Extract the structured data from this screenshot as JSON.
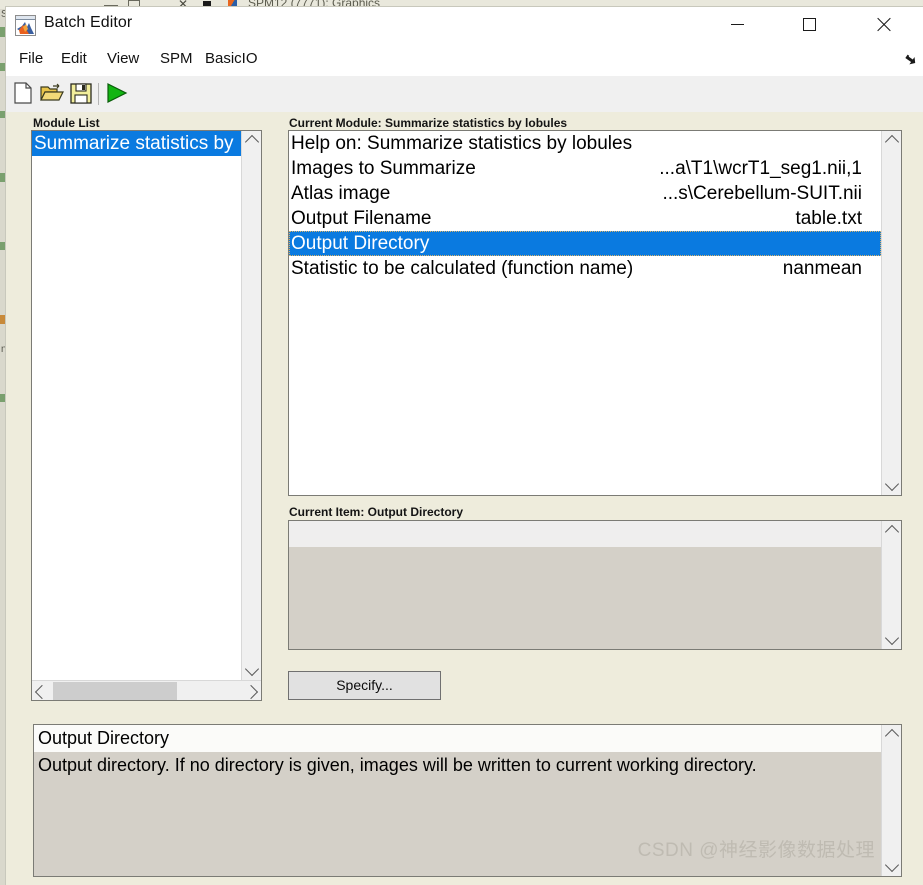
{
  "background": {
    "peek_window_title": "SPM12 (7771): Graphics"
  },
  "window": {
    "title": "Batch Editor",
    "icon": "matlab-icon",
    "controls": {
      "minimize": "minimize-icon",
      "maximize": "maximize-icon",
      "close": "close-icon"
    }
  },
  "menubar": {
    "items": [
      {
        "label": "File"
      },
      {
        "label": "Edit"
      },
      {
        "label": "View"
      },
      {
        "label": "SPM"
      },
      {
        "label": "BasicIO"
      }
    ],
    "resize_handle": "resize-arrow-icon"
  },
  "toolbar": {
    "buttons": [
      {
        "name": "new-batch-button",
        "icon": "new-file-icon"
      },
      {
        "name": "open-batch-button",
        "icon": "open-folder-icon"
      },
      {
        "name": "save-batch-button",
        "icon": "save-floppy-icon"
      },
      {
        "name": "run-batch-button",
        "icon": "run-play-icon"
      }
    ]
  },
  "module_list": {
    "label": "Module List",
    "items": [
      {
        "label": "Summarize statistics by",
        "selected": true
      }
    ]
  },
  "current_module": {
    "label_prefix": "Current Module: ",
    "label_value": "Summarize statistics by lobules",
    "label": "Current Module: Summarize statistics by lobules",
    "rows": [
      {
        "name": "Help on: Summarize statistics by lobules",
        "value": "",
        "selected": false
      },
      {
        "name": "Images to Summarize",
        "value": "...a\\T1\\wcrT1_seg1.nii,1",
        "selected": false
      },
      {
        "name": "Atlas image",
        "value": "...s\\Cerebellum-SUIT.nii",
        "selected": false
      },
      {
        "name": "Output Filename",
        "value": "table.txt",
        "selected": false
      },
      {
        "name": "Output Directory",
        "value": "",
        "selected": true
      },
      {
        "name": "Statistic to be calculated (function name)",
        "value": "nanmean",
        "selected": false
      }
    ]
  },
  "current_item": {
    "label_prefix": "Current Item: ",
    "label_value": "Output Directory",
    "label": "Current Item: Output Directory",
    "value": ""
  },
  "specify_button": {
    "label": "Specify..."
  },
  "help_panel": {
    "title": "Output Directory",
    "body": "Output directory. If no directory is given, images will be written to current working directory."
  },
  "watermark": {
    "text": "CSDN @神经影像数据处理"
  },
  "colors": {
    "window_bg": "#eeecdc",
    "selection_blue": "#0a7ae0",
    "panel_grey": "#d4d0c8",
    "run_green": "#0fa30f"
  }
}
